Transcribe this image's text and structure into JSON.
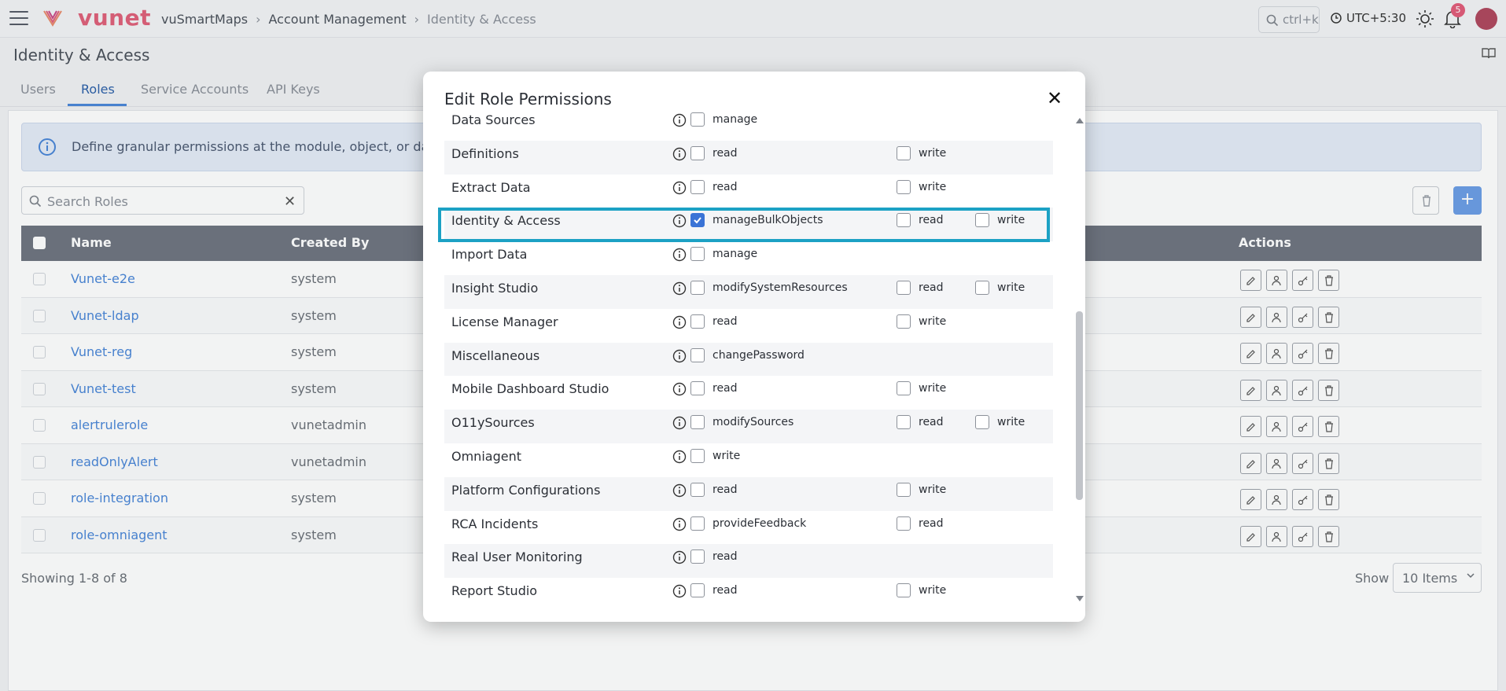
{
  "topbar": {
    "brand": "vunet",
    "breadcrumb": [
      "vuSmartMaps",
      "Account Management",
      "Identity & Access"
    ],
    "search_label": "ctrl+k",
    "timezone": "UTC+5:30",
    "notification_count": "5"
  },
  "page": {
    "title": "Identity & Access"
  },
  "tabs": [
    {
      "label": "Users"
    },
    {
      "label": "Roles",
      "active": true
    },
    {
      "label": "Service Accounts"
    },
    {
      "label": "API Keys"
    }
  ],
  "banner": {
    "text": "Define granular permissions at the module, object, or data-acc"
  },
  "roles_search": {
    "placeholder": "Search Roles"
  },
  "table": {
    "headers": {
      "name": "Name",
      "created_by": "Created By",
      "actions": "Actions"
    },
    "rows": [
      {
        "name": "Vunet-e2e",
        "created_by": "system"
      },
      {
        "name": "Vunet-ldap",
        "created_by": "system"
      },
      {
        "name": "Vunet-reg",
        "created_by": "system"
      },
      {
        "name": "Vunet-test",
        "created_by": "system"
      },
      {
        "name": "alertrulerole",
        "created_by": "vunetadmin"
      },
      {
        "name": "readOnlyAlert",
        "created_by": "vunetadmin"
      },
      {
        "name": "role-integration",
        "created_by": "system"
      },
      {
        "name": "role-omniagent",
        "created_by": "system"
      }
    ]
  },
  "footer": {
    "showing": "Showing 1-8 of 8",
    "show_label": "Show",
    "page_size": "10 Items"
  },
  "modal": {
    "title": "Edit Role Permissions",
    "permissions": [
      {
        "module": "Data Sources",
        "options": [
          {
            "label": "manage",
            "checked": false
          }
        ]
      },
      {
        "module": "Definitions",
        "options": [
          {
            "label": "read",
            "checked": false
          },
          {
            "label": "write",
            "checked": false
          }
        ]
      },
      {
        "module": "Extract Data",
        "options": [
          {
            "label": "read",
            "checked": false
          },
          {
            "label": "write",
            "checked": false
          }
        ]
      },
      {
        "module": "Identity & Access",
        "options": [
          {
            "label": "manageBulkObjects",
            "checked": true
          },
          {
            "label": "read",
            "checked": false
          },
          {
            "label": "write",
            "checked": false
          }
        ]
      },
      {
        "module": "Import Data",
        "options": [
          {
            "label": "manage",
            "checked": false
          }
        ]
      },
      {
        "module": "Insight Studio",
        "options": [
          {
            "label": "modifySystemResources",
            "checked": false
          },
          {
            "label": "read",
            "checked": false
          },
          {
            "label": "write",
            "checked": false
          }
        ]
      },
      {
        "module": "License Manager",
        "options": [
          {
            "label": "read",
            "checked": false
          },
          {
            "label": "write",
            "checked": false
          }
        ]
      },
      {
        "module": "Miscellaneous",
        "options": [
          {
            "label": "changePassword",
            "checked": false
          }
        ]
      },
      {
        "module": "Mobile Dashboard Studio",
        "options": [
          {
            "label": "read",
            "checked": false
          },
          {
            "label": "write",
            "checked": false
          }
        ]
      },
      {
        "module": "O11ySources",
        "options": [
          {
            "label": "modifySources",
            "checked": false
          },
          {
            "label": "read",
            "checked": false
          },
          {
            "label": "write",
            "checked": false
          }
        ]
      },
      {
        "module": "Omniagent",
        "options": [
          {
            "label": "write",
            "checked": false
          }
        ]
      },
      {
        "module": "Platform Configurations",
        "options": [
          {
            "label": "read",
            "checked": false
          },
          {
            "label": "write",
            "checked": false
          }
        ]
      },
      {
        "module": "RCA Incidents",
        "options": [
          {
            "label": "provideFeedback",
            "checked": false
          },
          {
            "label": "read",
            "checked": false
          }
        ]
      },
      {
        "module": "Real User Monitoring",
        "options": [
          {
            "label": "read",
            "checked": false
          }
        ]
      },
      {
        "module": "Report Studio",
        "options": [
          {
            "label": "read",
            "checked": false
          },
          {
            "label": "write",
            "checked": false
          }
        ]
      }
    ]
  },
  "colors": {
    "brand": "#e0607a",
    "accent": "#4a86d8",
    "highlight": "#1ca1c4",
    "checked": "#3a73d6"
  }
}
